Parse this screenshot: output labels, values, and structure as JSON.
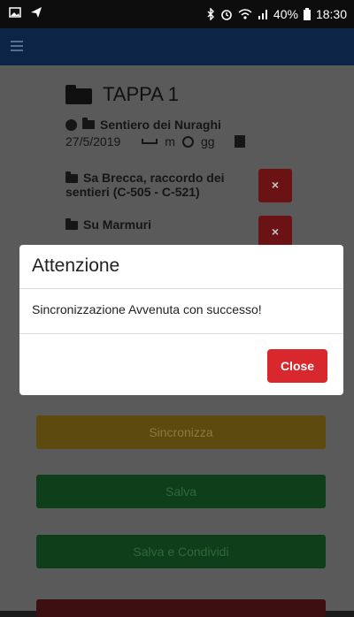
{
  "status_bar": {
    "battery": "40%",
    "time": "18:30"
  },
  "stage": {
    "title": "TAPPA 1"
  },
  "route": {
    "name": "Sentiero dei Nuraghi",
    "date": "27/5/2019",
    "distance_unit": "m",
    "duration_unit": "gg"
  },
  "sub_items": [
    {
      "label": "Sa Brecca, raccordo dei sentieri (C-505 - C-521)"
    },
    {
      "label": "Su Marmuri"
    }
  ],
  "delete_glyph": "×",
  "actions": {
    "sync_label": "Sincronizza",
    "save_label": "Salva",
    "save_share_label": "Salva e Condividi"
  },
  "dialog": {
    "title": "Attenzione",
    "message": "Sincronizzazione Avvenuta con successo!",
    "close_label": "Close"
  },
  "colors": {
    "app_bar": "#0c2547",
    "close_button": "#d9272e",
    "sync_button": "#5c4a0e",
    "save_button": "#0f3e1a",
    "delete_button": "#6b1214"
  },
  "icons": [
    "image-icon",
    "send-icon",
    "bluetooth-icon",
    "alarm-icon",
    "wifi-icon",
    "signal-icon",
    "battery-icon",
    "menu-icon",
    "folder-icon",
    "check-circle-icon",
    "ruler-icon",
    "clock-icon",
    "door-icon",
    "close-icon"
  ]
}
